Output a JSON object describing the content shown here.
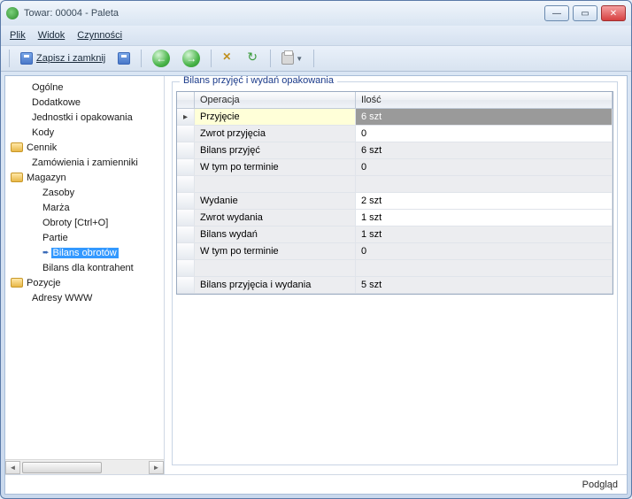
{
  "window": {
    "title": "Towar: 00004 - Paleta"
  },
  "menu": {
    "file": "Plik",
    "view": "Widok",
    "actions": "Czynności"
  },
  "toolbar": {
    "save_close": "Zapisz i zamknij"
  },
  "tree": {
    "items": [
      {
        "label": "Ogólne",
        "level": 1
      },
      {
        "label": "Dodatkowe",
        "level": 1
      },
      {
        "label": "Jednostki i opakowania",
        "level": 1
      },
      {
        "label": "Kody",
        "level": 1
      },
      {
        "label": "Cennik",
        "level": 0,
        "folder": true
      },
      {
        "label": "Zamówienia i zamienniki",
        "level": 1
      },
      {
        "label": "Magazyn",
        "level": 0,
        "folder": true
      },
      {
        "label": "Zasoby",
        "level": 2
      },
      {
        "label": "Marża",
        "level": 2
      },
      {
        "label": "Obroty [Ctrl+O]",
        "level": 2
      },
      {
        "label": "Partie",
        "level": 2
      },
      {
        "label": "Bilans obrotów",
        "level": 2,
        "selected": true
      },
      {
        "label": "Bilans dla kontrahent",
        "level": 2
      },
      {
        "label": "Pozycje",
        "level": 0,
        "folder": true
      },
      {
        "label": "Adresy WWW",
        "level": 1
      }
    ]
  },
  "panel": {
    "title": "Bilans przyjęć i wydań opakowania",
    "columns": {
      "op": "Operacja",
      "qty": "Ilość"
    },
    "rows": [
      {
        "op": "Przyjęcie",
        "qty": "6 szt",
        "active": true
      },
      {
        "op": "Zwrot przyjęcia",
        "qty": "0"
      },
      {
        "op": "Bilans przyjęć",
        "qty": "6 szt",
        "summary": true
      },
      {
        "op": "W tym po terminie",
        "qty": "0",
        "summary": true
      },
      {
        "spacer": true
      },
      {
        "op": "Wydanie",
        "qty": "2 szt"
      },
      {
        "op": "Zwrot wydania",
        "qty": "1 szt"
      },
      {
        "op": "Bilans wydań",
        "qty": "1 szt",
        "summary": true
      },
      {
        "op": "W tym po terminie",
        "qty": "0",
        "summary": true
      },
      {
        "spacer": true
      },
      {
        "op": "Bilans przyjęcia i wydania",
        "qty": "5 szt",
        "summary": true
      }
    ]
  },
  "footer": {
    "status": "Podgląd"
  }
}
